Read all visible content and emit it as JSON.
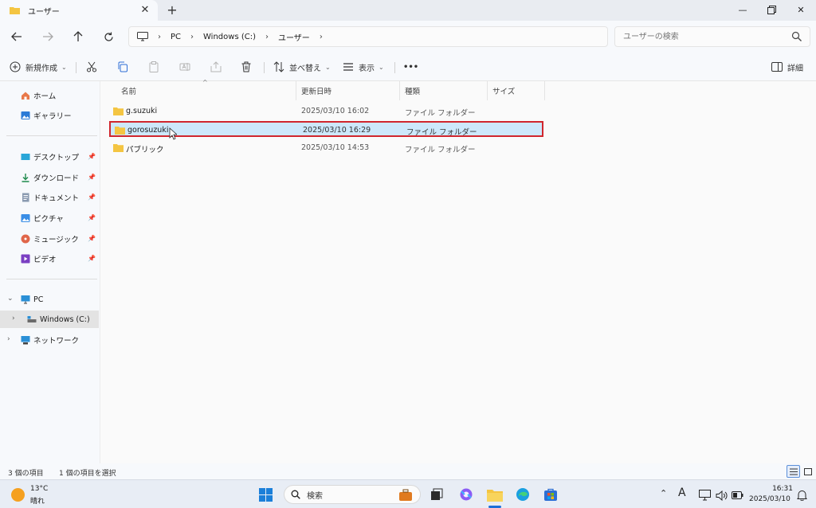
{
  "window": {
    "tab_title": "ユーザー",
    "tab_close": "✕",
    "new_tab": "+",
    "minimize": "—",
    "close": "✕"
  },
  "address": {
    "crumbs": [
      "PC",
      "Windows (C:)",
      "ユーザー"
    ],
    "separator": "›",
    "search_placeholder": "ユーザーの検索"
  },
  "commands": {
    "new": "新規作成",
    "sort": "並べ替え",
    "view": "表示",
    "more": "•••",
    "details": "詳細"
  },
  "sidebar": {
    "quick": [
      {
        "label": "ホーム",
        "icon": "home-icon"
      },
      {
        "label": "ギャラリー",
        "icon": "gallery-icon"
      }
    ],
    "pinned": [
      {
        "label": "デスクトップ",
        "icon": "desktop-icon"
      },
      {
        "label": "ダウンロード",
        "icon": "download-icon"
      },
      {
        "label": "ドキュメント",
        "icon": "document-icon"
      },
      {
        "label": "ピクチャ",
        "icon": "pictures-icon"
      },
      {
        "label": "ミュージック",
        "icon": "music-icon"
      },
      {
        "label": "ビデオ",
        "icon": "video-icon"
      }
    ],
    "pc": "PC",
    "drive": "Windows (C:)",
    "network": "ネットワーク"
  },
  "columns": {
    "name": "名前",
    "date": "更新日時",
    "type": "種類",
    "size": "サイズ"
  },
  "files": [
    {
      "name": "g.suzuki",
      "date": "2025/03/10 16:02",
      "type": "ファイル フォルダー",
      "selected": false
    },
    {
      "name": "gorosuzuki",
      "date": "2025/03/10 16:29",
      "type": "ファイル フォルダー",
      "selected": true
    },
    {
      "name": "パブリック",
      "date": "2025/03/10 14:53",
      "type": "ファイル フォルダー",
      "selected": false
    }
  ],
  "status": {
    "count": "3 個の項目",
    "selection": "1 個の項目を選択"
  },
  "taskbar": {
    "temperature": "13°C",
    "weather": "晴れ",
    "search": "検索",
    "time": "16:31",
    "date": "2025/03/10",
    "ime": "A"
  },
  "colors": {
    "selection_bg": "#cde8fb",
    "highlight_border": "#d0262d",
    "folder": "#f4c542",
    "accent": "#1d6ed8"
  }
}
